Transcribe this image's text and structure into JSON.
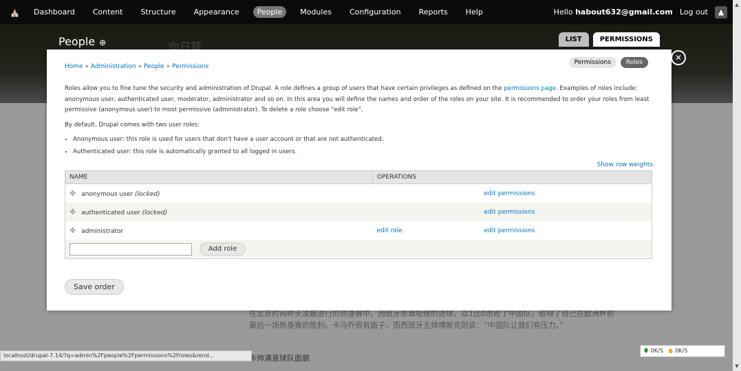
{
  "toolbar": {
    "home_icon": "home-icon",
    "menu": [
      "Dashboard",
      "Content",
      "Structure",
      "Appearance",
      "People",
      "Modules",
      "Configuration",
      "Reports",
      "Help"
    ],
    "active": "People",
    "hello": "Hello ",
    "user": "habout632@gmail.com",
    "logout": "Log out"
  },
  "page": {
    "title": "People",
    "tabs": [
      "LIST",
      "PERMISSIONS"
    ],
    "ghost_text": "向日葵"
  },
  "modal": {
    "breadcrumb": [
      "Home",
      "Administration",
      "People",
      "Permissions"
    ],
    "local_tabs": [
      "Permissions",
      "Roles"
    ],
    "desc_p1_a": "Roles allow you to fine tune the security and administration of Drupal. A role defines a group of users that have certain privileges as defined on the ",
    "desc_link": "permissions page",
    "desc_p1_b": ". Examples of roles include: anonymous user, authenticated user, moderator, administrator and so on. In this area you will define the names and order of the roles on your site. It is recommended to order your roles from least permissive (anonymous user) to most permissive (administrator). To delete a role choose \"edit role\".",
    "desc_p2": "By default, Drupal comes with two user roles:",
    "bullets": [
      "Anonymous user: this role is used for users that don't have a user account or that are not authenticated.",
      "Authenticated user: this role is automatically granted to all logged in users."
    ],
    "show_row_weights": "Show row weights",
    "table": {
      "headers": [
        "NAME",
        "OPERATIONS"
      ],
      "rows": [
        {
          "name": "anonymous user",
          "locked": "(locked)",
          "edit_role": "",
          "edit_permissions": "edit permissions"
        },
        {
          "name": "authenticated user",
          "locked": "(locked)",
          "edit_role": "",
          "edit_permissions": "edit permissions"
        },
        {
          "name": "administrator",
          "locked": "",
          "edit_role": "edit role",
          "edit_permissions": "edit permissions"
        }
      ]
    },
    "add_role": "Add role",
    "save_order": "Save order"
  },
  "background": {
    "lines": [
      "在北京时间昨天凌晨进行的热身赛中，西班牙依靠哈维的进球，以1比0击败了中国队，取得了自己在欧洲杯前最后一场热身赛的胜利。卡马乔很有面子，而西班牙主帅博斯克则说：“中国队让我们有压力。”"
    ],
    "heading": "卡帅满意球队面貌"
  },
  "statusbar": {
    "url": "localhost/drupal-7.14/?q=admin%2Fpeople%2Fpermissions%2Froles&rend..."
  },
  "netmon": {
    "down": "0K/S",
    "up": "0K/S"
  }
}
